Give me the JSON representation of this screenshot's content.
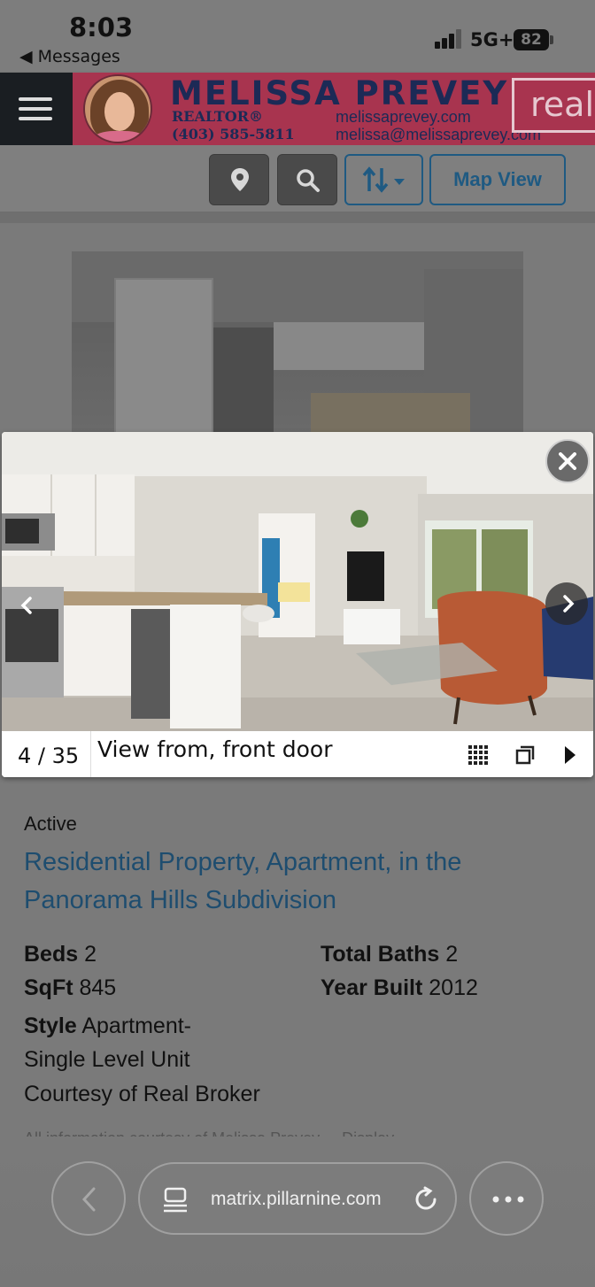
{
  "status_bar": {
    "time": "8:03",
    "back_label": "◀ Messages",
    "network": "5G+",
    "battery": "82"
  },
  "banner": {
    "name": "MELISSA PREVEY",
    "title": "REALTOR®",
    "phone": "(403) 585-5811",
    "website": "melissaprevey.com",
    "email": "melissa@melissaprevey.com",
    "brokerage_logo": "real"
  },
  "toolbar": {
    "location_icon": "map-pin-icon",
    "search_icon": "search-icon",
    "sort_icon": "sort-icon",
    "map_view_label": "Map View"
  },
  "lightbox": {
    "counter": "4 / 35",
    "caption": "View from, front door"
  },
  "listing": {
    "status": "Active",
    "title": "Residential Property, Apartment, in the Panorama Hills Subdivision",
    "beds_label": "Beds",
    "beds": "2",
    "sqft_label": "SqFt",
    "sqft": "845",
    "style_label": "Style",
    "style": "Apartment-Single Level Unit",
    "baths_label": "Total Baths",
    "baths": "2",
    "year_label": "Year Built",
    "year": "2012",
    "courtesy": "Courtesy of Real Broker",
    "disclaimer": "All information courtesy of Melissa Prevey ... Display"
  },
  "browser": {
    "url": "matrix.pillarnine.com"
  },
  "colors": {
    "banner_bg": "#a8344f",
    "brand_navy": "#1c2a56",
    "link_blue": "#1e4d6f"
  }
}
